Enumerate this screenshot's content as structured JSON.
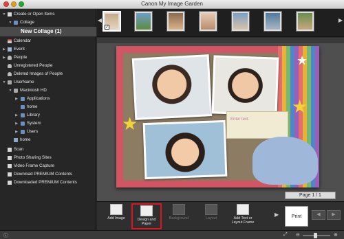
{
  "window": {
    "title": "Canon My Image Garden"
  },
  "sidebar": {
    "items": [
      {
        "label": "Create or Open Items",
        "arrow": "▼",
        "icon": "create-icon"
      },
      {
        "label": "Collage",
        "arrow": "▼",
        "icon": "collage-folder-icon"
      },
      {
        "label": "New Collage (1)",
        "arrow": "",
        "icon": ""
      },
      {
        "label": "Calendar",
        "arrow": "",
        "icon": "calendar-icon"
      },
      {
        "label": "Event",
        "arrow": "▶",
        "icon": "event-icon"
      },
      {
        "label": "People",
        "arrow": "▶",
        "icon": "people-icon"
      },
      {
        "label": "Unregistered People",
        "arrow": "",
        "icon": "unregistered-people-icon"
      },
      {
        "label": "Deleted Images of People",
        "arrow": "",
        "icon": "deleted-people-icon"
      },
      {
        "label": "UserName",
        "arrow": "▼",
        "icon": "user-icon"
      },
      {
        "label": "Macintosh HD",
        "arrow": "▼",
        "icon": "drive-icon"
      },
      {
        "label": "Applications",
        "arrow": "▶",
        "icon": "folder-icon"
      },
      {
        "label": "home",
        "arrow": "",
        "icon": "folder-icon"
      },
      {
        "label": "Library",
        "arrow": "▶",
        "icon": "folder-icon"
      },
      {
        "label": "System",
        "arrow": "▶",
        "icon": "folder-icon"
      },
      {
        "label": "Users",
        "arrow": "▶",
        "icon": "folder-icon"
      },
      {
        "label": "home",
        "arrow": "",
        "icon": "home-icon"
      },
      {
        "label": "Scan",
        "arrow": "",
        "icon": "scan-icon"
      },
      {
        "label": "Photo Sharing Sites",
        "arrow": "",
        "icon": "photo-sharing-icon"
      },
      {
        "label": "Video Frame Capture",
        "arrow": "",
        "icon": "video-capture-icon"
      },
      {
        "label": "Download PREMIUM Contents",
        "arrow": "",
        "icon": "download-icon"
      },
      {
        "label": "Downloaded PREMIUM Contents",
        "arrow": "",
        "icon": "downloaded-icon"
      }
    ]
  },
  "editor": {
    "text_placeholder": "Enter text.",
    "page_indicator": "Page 1 / 1"
  },
  "toolbar": {
    "add_image": "Add Image",
    "design_paper": "Design and Paper",
    "background": "Background",
    "layout": "Layout",
    "add_text": "Add Text or Layout Frame",
    "print": "Print"
  },
  "colors": {
    "highlight": "#e0141e",
    "canvas": "#d25563",
    "sidebar_bg": "#262626"
  }
}
